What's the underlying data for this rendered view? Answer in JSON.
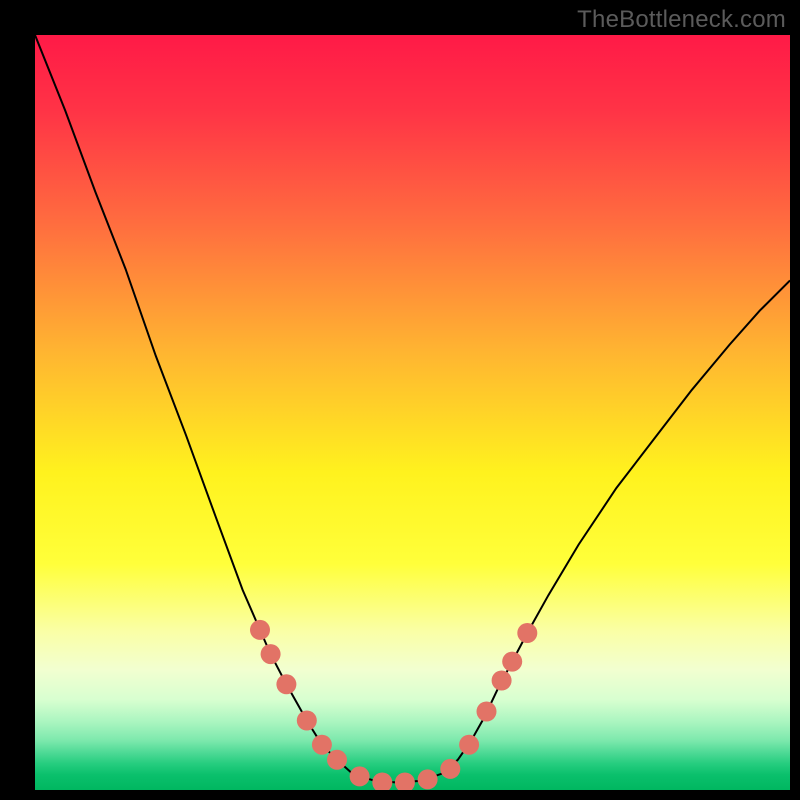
{
  "watermark": "TheBottleneck.com",
  "chart_data": {
    "type": "line",
    "title": "",
    "xlabel": "",
    "ylabel": "",
    "xlim": [
      0,
      1
    ],
    "ylim": [
      0,
      1
    ],
    "curve": [
      {
        "x": 0.0,
        "y": 1.0
      },
      {
        "x": 0.04,
        "y": 0.9
      },
      {
        "x": 0.08,
        "y": 0.792
      },
      {
        "x": 0.12,
        "y": 0.69
      },
      {
        "x": 0.16,
        "y": 0.575
      },
      {
        "x": 0.2,
        "y": 0.47
      },
      {
        "x": 0.24,
        "y": 0.36
      },
      {
        "x": 0.275,
        "y": 0.265
      },
      {
        "x": 0.298,
        "y": 0.212
      },
      {
        "x": 0.312,
        "y": 0.18
      },
      {
        "x": 0.333,
        "y": 0.14
      },
      {
        "x": 0.36,
        "y": 0.092
      },
      {
        "x": 0.38,
        "y": 0.06
      },
      {
        "x": 0.4,
        "y": 0.04
      },
      {
        "x": 0.42,
        "y": 0.022
      },
      {
        "x": 0.45,
        "y": 0.012
      },
      {
        "x": 0.48,
        "y": 0.01
      },
      {
        "x": 0.51,
        "y": 0.012
      },
      {
        "x": 0.54,
        "y": 0.022
      },
      {
        "x": 0.56,
        "y": 0.04
      },
      {
        "x": 0.578,
        "y": 0.066
      },
      {
        "x": 0.595,
        "y": 0.096
      },
      {
        "x": 0.612,
        "y": 0.132
      },
      {
        "x": 0.632,
        "y": 0.17
      },
      {
        "x": 0.652,
        "y": 0.208
      },
      {
        "x": 0.68,
        "y": 0.258
      },
      {
        "x": 0.72,
        "y": 0.325
      },
      {
        "x": 0.77,
        "y": 0.4
      },
      {
        "x": 0.82,
        "y": 0.465
      },
      {
        "x": 0.87,
        "y": 0.53
      },
      {
        "x": 0.92,
        "y": 0.59
      },
      {
        "x": 0.96,
        "y": 0.635
      },
      {
        "x": 1.0,
        "y": 0.675
      }
    ],
    "markers": [
      {
        "x": 0.298,
        "y": 0.212
      },
      {
        "x": 0.312,
        "y": 0.18
      },
      {
        "x": 0.333,
        "y": 0.14
      },
      {
        "x": 0.36,
        "y": 0.092
      },
      {
        "x": 0.38,
        "y": 0.06
      },
      {
        "x": 0.4,
        "y": 0.04
      },
      {
        "x": 0.43,
        "y": 0.018
      },
      {
        "x": 0.46,
        "y": 0.01
      },
      {
        "x": 0.49,
        "y": 0.01
      },
      {
        "x": 0.52,
        "y": 0.014
      },
      {
        "x": 0.55,
        "y": 0.028
      },
      {
        "x": 0.575,
        "y": 0.06
      },
      {
        "x": 0.598,
        "y": 0.104
      },
      {
        "x": 0.618,
        "y": 0.145
      },
      {
        "x": 0.632,
        "y": 0.17
      },
      {
        "x": 0.652,
        "y": 0.208
      }
    ],
    "gradient_stops": [
      {
        "offset": 0.0,
        "color": "#ff1a47"
      },
      {
        "offset": 0.1,
        "color": "#ff3346"
      },
      {
        "offset": 0.25,
        "color": "#ff6d3f"
      },
      {
        "offset": 0.42,
        "color": "#ffb531"
      },
      {
        "offset": 0.58,
        "color": "#fff21e"
      },
      {
        "offset": 0.7,
        "color": "#ffff3a"
      },
      {
        "offset": 0.79,
        "color": "#faffa6"
      },
      {
        "offset": 0.84,
        "color": "#f2ffd0"
      },
      {
        "offset": 0.88,
        "color": "#d8ffd0"
      },
      {
        "offset": 0.91,
        "color": "#aaf5c0"
      },
      {
        "offset": 0.935,
        "color": "#7be8ac"
      },
      {
        "offset": 0.95,
        "color": "#4fda96"
      },
      {
        "offset": 0.965,
        "color": "#26cd7f"
      },
      {
        "offset": 0.98,
        "color": "#0ac06c"
      },
      {
        "offset": 1.0,
        "color": "#00b760"
      }
    ],
    "marker_color": "#e27366",
    "curve_color": "#000000"
  }
}
